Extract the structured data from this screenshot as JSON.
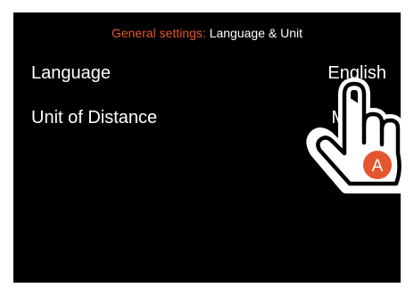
{
  "header": {
    "prefix": "General settings:",
    "title": "Language & Unit"
  },
  "settings": [
    {
      "label": "Language",
      "value": "English"
    },
    {
      "label": "Unit of Distance",
      "value": "M"
    }
  ],
  "pointer": {
    "icon": "tap-hand-icon",
    "badge": "A"
  },
  "colors": {
    "background": "#000000",
    "accent": "#e4572e",
    "text": "#ffffff"
  }
}
